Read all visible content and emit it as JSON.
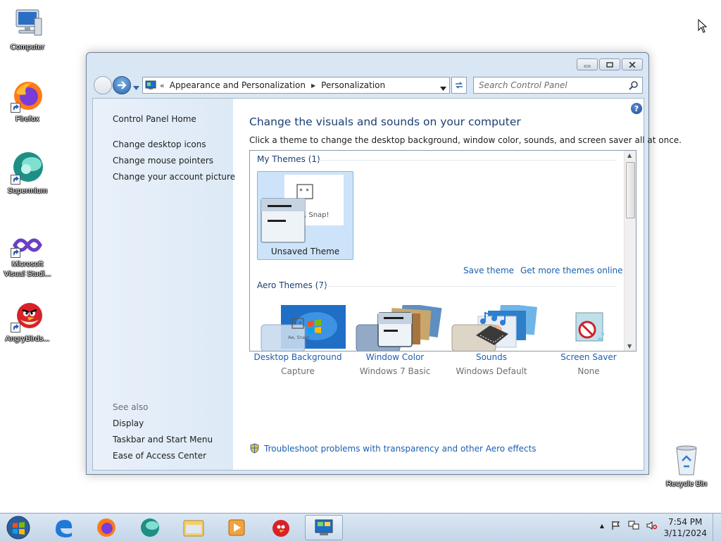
{
  "desktop": {
    "icons": [
      {
        "label": "Computer"
      },
      {
        "label": "Firefox"
      },
      {
        "label": "Supermium"
      },
      {
        "label": "Microsoft Visual Studi..."
      },
      {
        "label": "AngryBirds..."
      },
      {
        "label": "Recycle Bin"
      }
    ]
  },
  "window": {
    "address": {
      "chevron": "«",
      "crumbs": [
        "Appearance and Personalization",
        "Personalization"
      ]
    },
    "search_placeholder": "Search Control Panel",
    "sidebar": {
      "home": "Control Panel Home",
      "links": [
        "Change desktop icons",
        "Change mouse pointers",
        "Change your account picture"
      ],
      "see_also_heading": "See also",
      "see_also": [
        "Display",
        "Taskbar and Start Menu",
        "Ease of Access Center"
      ]
    },
    "main": {
      "help_glyph": "?",
      "heading": "Change the visuals and sounds on your computer",
      "subtext": "Click a theme to change the desktop background, window color, sounds, and screen saver all at once.",
      "my_themes_header": "My Themes (1)",
      "unsaved_theme_label": "Unsaved Theme",
      "thumb_snap_text": ", Snap!",
      "save_theme": "Save theme",
      "get_more": "Get more themes online",
      "aero_header": "Aero Themes (7)",
      "bottom": [
        {
          "link": "Desktop Background",
          "value": "Capture",
          "icon": "desktop-background-icon",
          "small": "Aw, Snap!"
        },
        {
          "link": "Window Color",
          "value": "Windows 7 Basic",
          "icon": "window-color-icon"
        },
        {
          "link": "Sounds",
          "value": "Windows Default",
          "icon": "sounds-icon"
        },
        {
          "link": "Screen Saver",
          "value": "None",
          "icon": "screen-saver-icon"
        }
      ],
      "troubleshoot": "Troubleshoot problems with transparency and other Aero effects"
    }
  },
  "taskbar": {
    "time": "7:54 PM",
    "date": "3/11/2024"
  }
}
